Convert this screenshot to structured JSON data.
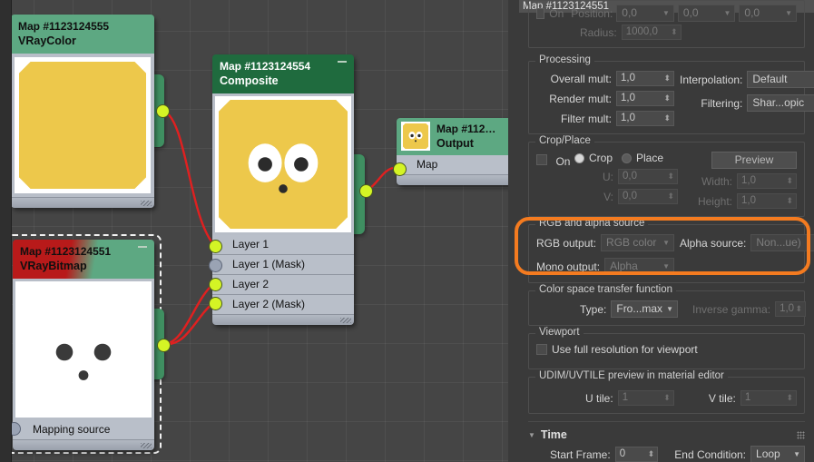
{
  "editor": {
    "background_color": "#454545",
    "nodes": [
      {
        "id": "vraycolor",
        "title": "Map #1123124555",
        "type": "VRayColor",
        "header_color": "#5da882",
        "title_color": "#101010",
        "selected": false,
        "rows": []
      },
      {
        "id": "composite",
        "title": "Map #1123124554",
        "type": "Composite",
        "header_color": "#1f6b3e",
        "title_color": "#ffffff",
        "selected": false,
        "rows": [
          {
            "label": "Layer 1",
            "port": "connected"
          },
          {
            "label": "Layer 1 (Mask)",
            "port": "empty"
          },
          {
            "label": "Layer 2",
            "port": "connected"
          },
          {
            "label": "Layer 2 (Mask)",
            "port": "connected"
          }
        ]
      },
      {
        "id": "output",
        "title": "Map  #112…",
        "type": "Output",
        "header_color": "#5da882",
        "title_color": "#101010",
        "selected": false,
        "rows": [
          {
            "label": "Map",
            "port": "connected"
          }
        ]
      },
      {
        "id": "vraybitmap",
        "title": "Map #1123124551",
        "type": "VRayBitmap",
        "header_color": "#5da882",
        "header_color_2": "#b81a1a",
        "title_color": "#101010",
        "selected": true,
        "rows": [
          {
            "label": "Mapping source",
            "port": "empty"
          }
        ]
      }
    ],
    "wire_color": "#e02020",
    "port_connected_color": "#d4f425",
    "port_empty_color": "#9aa3b4"
  },
  "panel": {
    "titlebar": "Map #1123124551",
    "scrolled_group": {
      "on_label": "On",
      "position_label": "Position:",
      "position_values": [
        "0,0",
        "0,0",
        "0,0"
      ],
      "radius_label": "Radius:",
      "radius_value": "1000,0"
    },
    "processing": {
      "legend": "Processing",
      "overall_mult_label": "Overall mult:",
      "overall_mult_value": "1,0",
      "render_mult_label": "Render mult:",
      "render_mult_value": "1,0",
      "filter_mult_label": "Filter mult:",
      "filter_mult_value": "1,0",
      "interpolation_label": "Interpolation:",
      "interpolation_value": "Default",
      "filtering_label": "Filtering:",
      "filtering_value": "Shar...opic"
    },
    "crop_place": {
      "legend": "Crop/Place",
      "on_label": "On",
      "crop_label": "Crop",
      "place_label": "Place",
      "selected_mode": "Crop",
      "preview_label": "Preview",
      "u_label": "U:",
      "u_value": "0,0",
      "v_label": "V:",
      "v_value": "0,0",
      "width_label": "Width:",
      "width_value": "1,0",
      "height_label": "Height:",
      "height_value": "1,0"
    },
    "rgb_alpha": {
      "legend": "RGB and alpha source",
      "rgb_output_label": "RGB output:",
      "rgb_output_value": "RGB color",
      "mono_output_label": "Mono output:",
      "mono_output_value": "Alpha",
      "alpha_source_label": "Alpha source:",
      "alpha_source_value": "Non...ue)",
      "highlight_color": "#f47b20"
    },
    "color_space": {
      "legend": "Color space transfer function",
      "type_label": "Type:",
      "type_value": "Fro...max",
      "inverse_gamma_label": "Inverse gamma:",
      "inverse_gamma_value": "1,0"
    },
    "viewport": {
      "legend": "Viewport",
      "full_res_label": "Use full resolution for viewport"
    },
    "udim": {
      "legend": "UDIM/UVTILE preview in material editor",
      "u_tile_label": "U tile:",
      "u_tile_value": "1",
      "v_tile_label": "V tile:",
      "v_tile_value": "1"
    },
    "time": {
      "rollup_label": "Time",
      "start_frame_label": "Start Frame:",
      "start_frame_value": "0",
      "end_condition_label": "End Condition:",
      "end_condition_value": "Loop"
    }
  }
}
